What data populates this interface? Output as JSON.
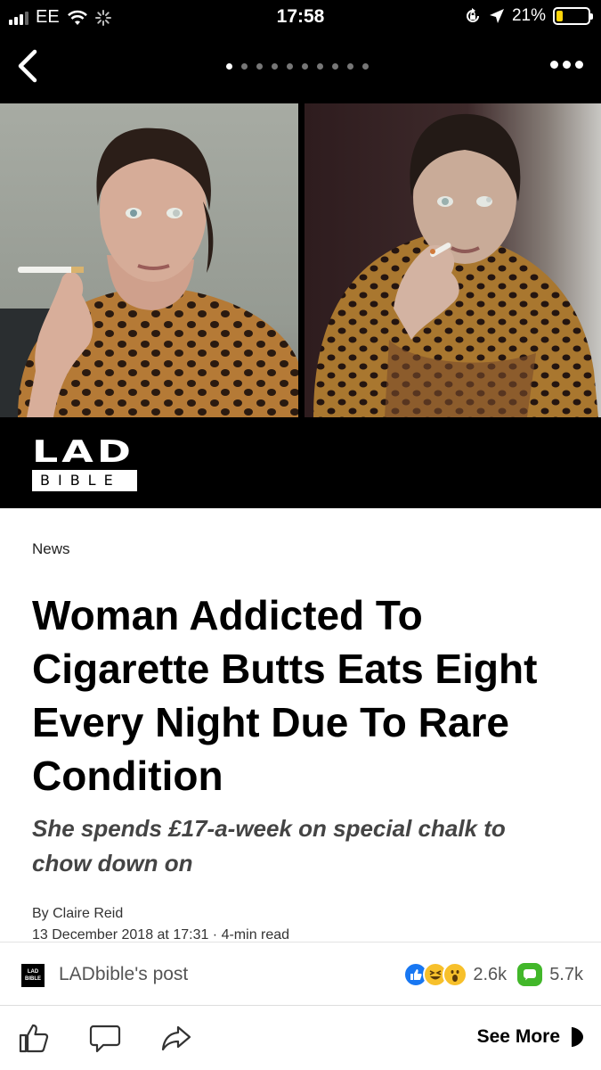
{
  "status_bar": {
    "carrier": "EE",
    "time": "17:58",
    "battery": "21%",
    "battery_level": 0.21
  },
  "nav": {
    "page_dots_total": 10,
    "page_dots_active": 0
  },
  "brand": {
    "logo_top": "LAD",
    "logo_bottom": "BIBLE"
  },
  "article": {
    "category": "News",
    "headline": "Woman Addicted To Cigarette Butts Eats Eight Every Night Due To Rare Condition",
    "subhead": "She spends £17-a-week on special chalk to chow down on",
    "byline": "By Claire Reid",
    "date": "13 December 2018 at 17:31 · 4-min read"
  },
  "post": {
    "avatar_text_1": "LAD",
    "avatar_text_2": "BIBLE",
    "owner": "LADbible's post",
    "reaction_count": "2.6k",
    "comment_count": "5.7k"
  },
  "actions": {
    "see_more": "See More"
  },
  "colors": {
    "like_blue": "#1877f2",
    "comment_green": "#42b72a",
    "emoji_yellow": "#f7c02b",
    "battery_yellow": "#ffd60a"
  }
}
